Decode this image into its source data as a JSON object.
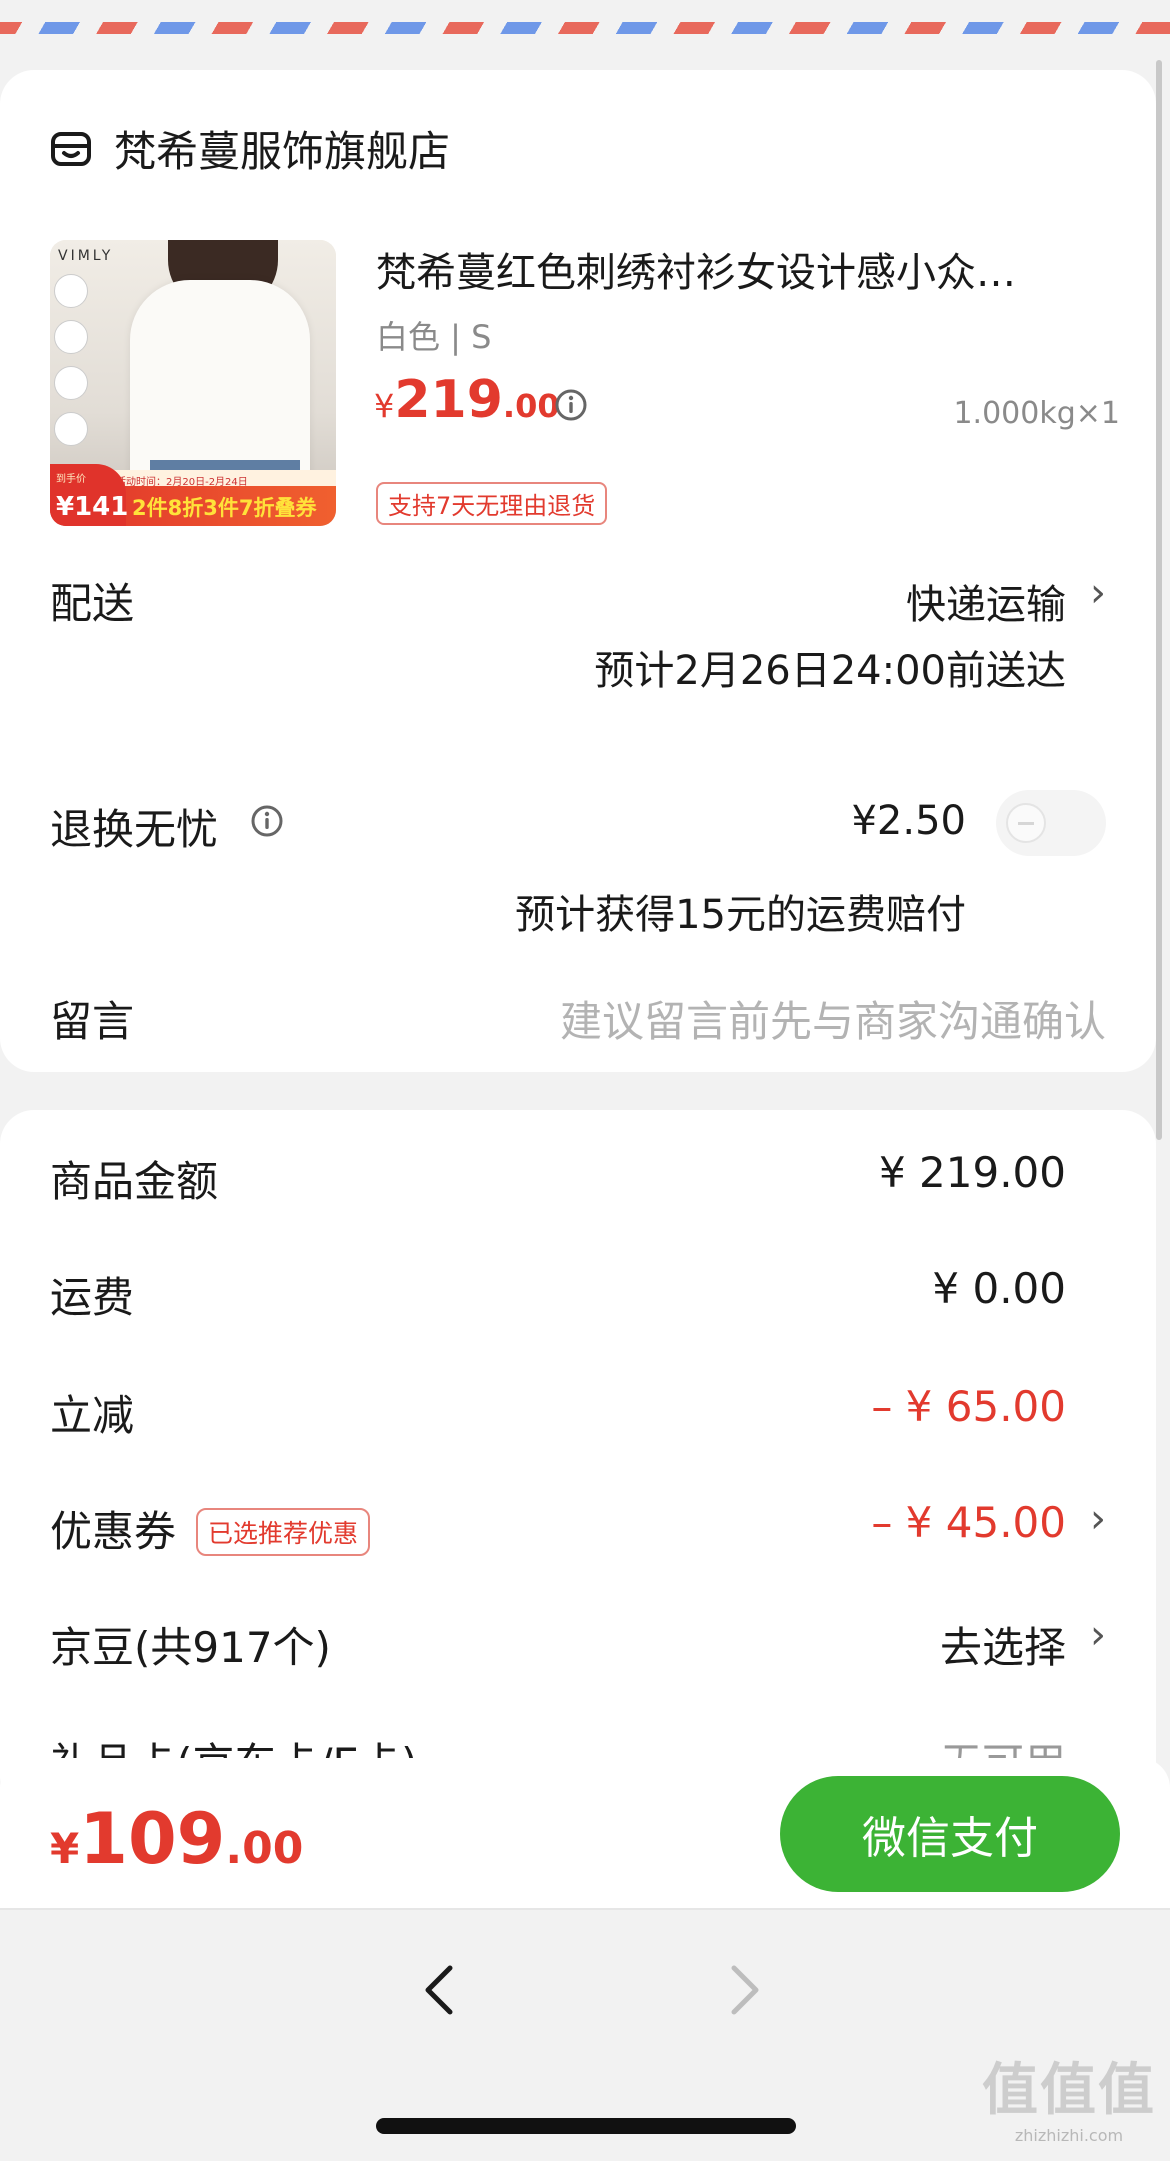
{
  "store": {
    "name": "梵希蔓服饰旗舰店",
    "icon": "store-icon"
  },
  "product": {
    "title": "梵希蔓红色刺绣衬衫女设计感小众…",
    "spec": "白色 | S",
    "price_yen": "¥",
    "price_int": "219",
    "price_dec": ".00",
    "weight": "1.000kg×1",
    "tag": "支持7天无理由退货",
    "thumb": {
      "logo": "VIMLY",
      "activity": "活动时间：2月20日-2月24日",
      "badge_top": "到手价",
      "badge_price": "¥141",
      "promo": "2件8折3件7折叠券"
    }
  },
  "delivery": {
    "label": "配送",
    "method": "快递运输",
    "eta": "预计2月26日24:00前送达"
  },
  "return_service": {
    "label": "退换无忧",
    "price": "¥2.50",
    "note": "预计获得15元的运费赔付",
    "enabled": false
  },
  "message": {
    "label": "留言",
    "placeholder": "建议留言前先与商家沟通确认"
  },
  "summary": {
    "goods_label": "商品金额",
    "goods_value": "¥ 219.00",
    "shipping_label": "运费",
    "shipping_value": "¥ 0.00",
    "discount_label": "立减",
    "discount_value": "– ¥ 65.00",
    "coupon_label": "优惠券",
    "coupon_tag": "已选推荐优惠",
    "coupon_value": "– ¥ 45.00",
    "beans_label": "京豆(共917个)",
    "beans_value": "去选择",
    "giftcard_label": "礼品卡(京东卡/E卡)",
    "giftcard_value": "无可用"
  },
  "footer": {
    "total_yen": "¥",
    "total_int": "109",
    "total_dec": ".00",
    "pay_label": "微信支付"
  },
  "watermark": {
    "text": "值值值",
    "site": "zhizhizhi.com"
  },
  "colors": {
    "accent_red": "#e23a2e",
    "pay_green": "#3cb335"
  }
}
